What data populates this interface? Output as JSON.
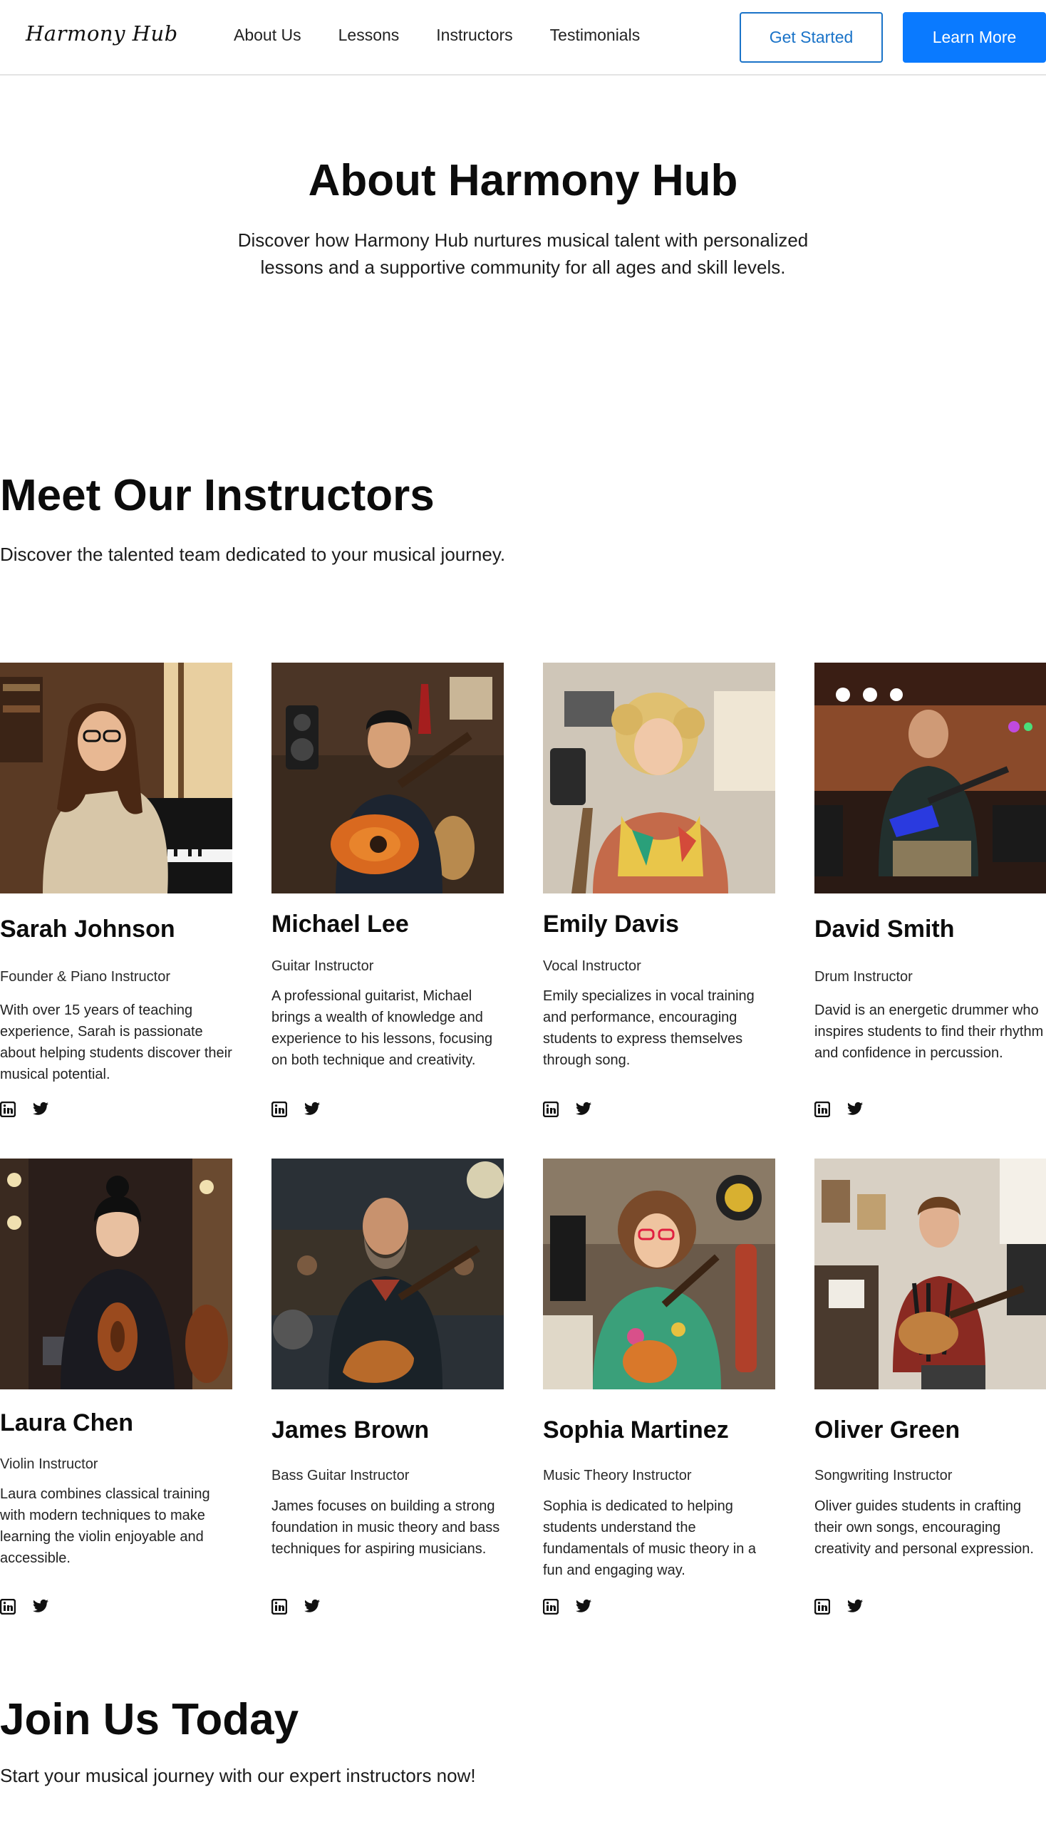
{
  "nav": {
    "logo": "Harmony Hub",
    "links": [
      "About Us",
      "Lessons",
      "Instructors",
      "Testimonials"
    ],
    "get_started": "Get Started",
    "learn_more": "Learn More"
  },
  "about": {
    "title": "About Harmony Hub",
    "text": "Discover how Harmony Hub nurtures musical talent with personalized lessons and a supportive community for all ages and skill levels."
  },
  "instructors_section": {
    "title": "Meet Our Instructors",
    "subtitle": "Discover the talented team dedicated to your musical journey."
  },
  "instructors": [
    {
      "name": "Sarah Johnson",
      "role": "Founder & Piano Instructor",
      "bio": "With over 15 years of teaching experience, Sarah is passionate about helping students discover their musical potential.",
      "photo": "piano"
    },
    {
      "name": "Michael Lee",
      "role": "Guitar Instructor",
      "bio": "A professional guitarist, Michael brings a wealth of knowledge and experience to his lessons, focusing on both technique and creativity.",
      "photo": "acoustic-guitar"
    },
    {
      "name": "Emily Davis",
      "role": "Vocal Instructor",
      "bio": "Emily specializes in vocal training and performance, encouraging students to express themselves through song.",
      "photo": "vocal"
    },
    {
      "name": "David Smith",
      "role": "Drum Instructor",
      "bio": "David is an energetic drummer who inspires students to find their rhythm and confidence in percussion.",
      "photo": "electric-guitar"
    },
    {
      "name": "Laura Chen",
      "role": "Violin Instructor",
      "bio": "Laura combines classical training with modern techniques to make learning the violin enjoyable and accessible.",
      "photo": "violin"
    },
    {
      "name": "James Brown",
      "role": "Bass Guitar Instructor",
      "bio": "James focuses on building a strong foundation in music theory and bass techniques for aspiring musicians.",
      "photo": "bass"
    },
    {
      "name": "Sophia Martinez",
      "role": "Music Theory Instructor",
      "bio": "Sophia is dedicated to helping students understand the fundamentals of music theory in a fun and engaging way.",
      "photo": "ukulele"
    },
    {
      "name": "Oliver Green",
      "role": "Songwriting Instructor",
      "bio": "Oliver guides students in crafting their own songs, encouraging creativity and personal expression.",
      "photo": "songwriting"
    }
  ],
  "join": {
    "title": "Join Us Today",
    "subtitle": "Start your musical journey with our expert instructors now!"
  },
  "colors": {
    "accent": "#0a7aff",
    "outline": "#1a73c8"
  },
  "icons": [
    "linkedin-icon",
    "twitter-icon"
  ]
}
